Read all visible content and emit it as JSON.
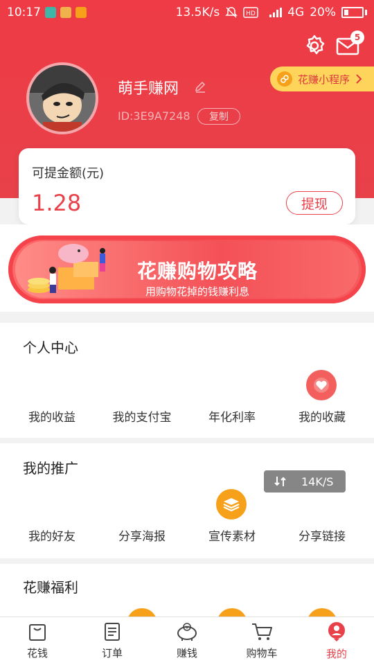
{
  "status_bar": {
    "time": "10:17",
    "network_speed": "13.5K/s",
    "network_type": "4G",
    "battery": "20%"
  },
  "header": {
    "mail_badge_count": "5",
    "mini_program_label": "花赚小程序",
    "username": "萌手赚网",
    "user_id": "ID:3E9A7248",
    "copy_label": "复制"
  },
  "balance": {
    "label": "可提金额(元)",
    "value": "1.28",
    "withdraw_label": "提现"
  },
  "banner": {
    "title": "花赚购物攻略",
    "subtitle": "用购物花掉的钱赚利息"
  },
  "personal_center": {
    "title": "个人中心",
    "items": [
      {
        "label": "我的收益"
      },
      {
        "label": "我的支付宝"
      },
      {
        "label": "年化利率"
      },
      {
        "label": "我的收藏"
      }
    ]
  },
  "promotion": {
    "title": "我的推广",
    "items": [
      {
        "label": "我的好友"
      },
      {
        "label": "分享海报"
      },
      {
        "label": "宣传素材"
      },
      {
        "label": "分享链接"
      }
    ],
    "speed_overlay": "14K/S"
  },
  "welfare": {
    "title": "花赚福利"
  },
  "bottom_nav": {
    "items": [
      {
        "label": "花钱"
      },
      {
        "label": "订单"
      },
      {
        "label": "赚钱"
      },
      {
        "label": "购物车"
      },
      {
        "label": "我的"
      }
    ]
  },
  "colors": {
    "brand_red": "#e8414a",
    "accent_yellow": "#ffd45a",
    "accent_orange": "#f7a11a"
  }
}
